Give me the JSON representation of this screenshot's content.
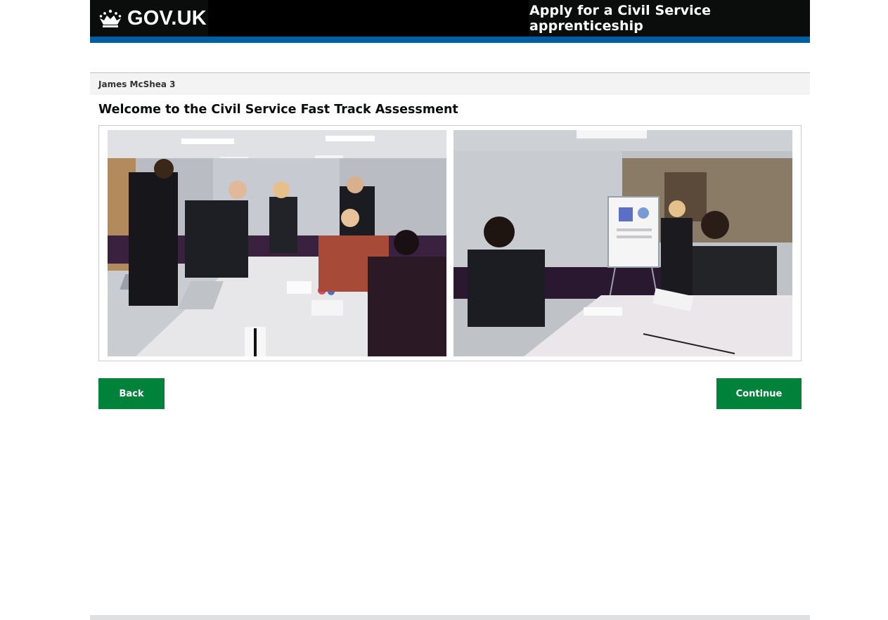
{
  "header": {
    "logo_text": "GOV.UK",
    "logo_icon": "crown-icon",
    "service_name": "Apply for a Civil Service apprenticeship"
  },
  "user": {
    "name": "James McShea 3"
  },
  "main": {
    "title": "Welcome to the Civil Service Fast Track Assessment",
    "images": [
      {
        "name": "meeting-handshake-photo"
      },
      {
        "name": "flipchart-presentation-photo"
      }
    ]
  },
  "actions": {
    "back_label": "Back",
    "continue_label": "Continue"
  },
  "colors": {
    "header_bg": "#0b0c0c",
    "accent_bar": "#005ea5",
    "button_green": "#00823b",
    "user_bar_bg": "#f3f3f3"
  }
}
